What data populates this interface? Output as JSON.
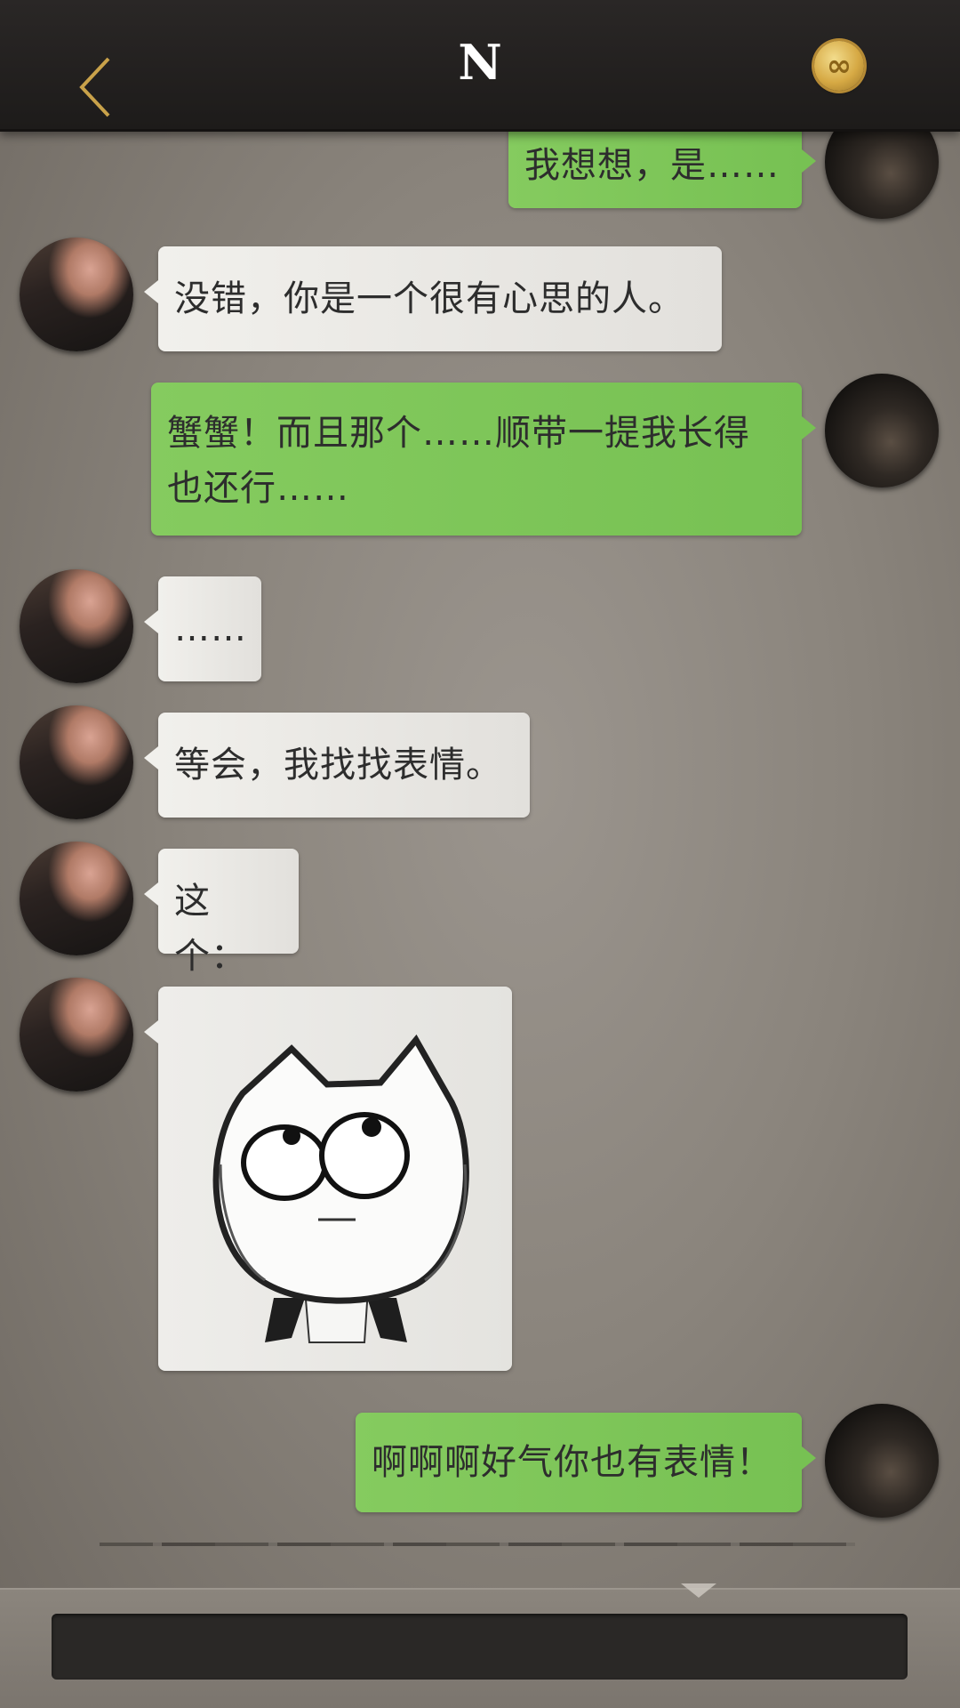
{
  "header": {
    "title": "N",
    "coin_symbol": "∞",
    "back_icon": "chevron-left-icon"
  },
  "messages": [
    {
      "side": "out",
      "text": "我想想，是……"
    },
    {
      "side": "in",
      "text": "没错，你是一个很有心思的人。"
    },
    {
      "side": "out",
      "text": "蟹蟹！而且那个……顺带一提我长得也还行……"
    },
    {
      "side": "in",
      "text": "……"
    },
    {
      "side": "in",
      "text": "等会，我找找表情。"
    },
    {
      "side": "in",
      "text": "这个："
    },
    {
      "side": "in",
      "type": "sticker",
      "sticker_name": "cat-rolling-eyes-sticker"
    },
    {
      "side": "out",
      "text": "啊啊啊好气你也有表情！"
    }
  ],
  "input": {
    "value": "",
    "placeholder": ""
  },
  "colors": {
    "header_bg": "#1f1d1c",
    "accent_gold": "#c9a24a",
    "bubble_in": "#efeeea",
    "bubble_out": "#80c75a",
    "input_bg": "#2a2826"
  }
}
